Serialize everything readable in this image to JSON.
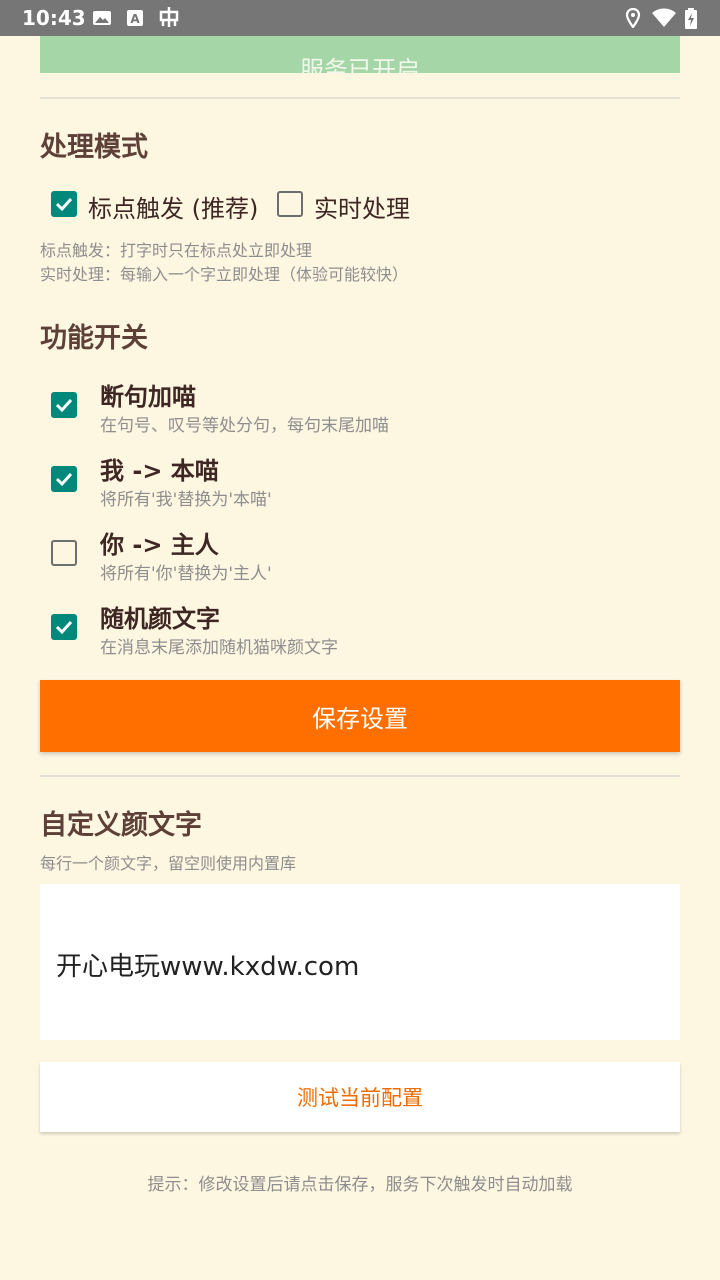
{
  "status_bar": {
    "time": "10:43",
    "left_icons": [
      "image-icon",
      "text-a-icon",
      "bug-icon"
    ],
    "right_icons": [
      "location-icon",
      "wifi-icon",
      "battery-icon"
    ]
  },
  "service_button": {
    "label": "服务已开启",
    "color": "#A5D6A7"
  },
  "mode_section": {
    "title": "处理模式",
    "options": [
      {
        "label": "标点触发 (推荐)",
        "checked": true
      },
      {
        "label": "实时处理",
        "checked": false
      }
    ],
    "desc_line1": "标点触发：打字时只在标点处立即处理",
    "desc_line2": "实时处理：每输入一个字立即处理（体验可能较快）"
  },
  "features_section": {
    "title": "功能开关",
    "items": [
      {
        "title": "断句加喵",
        "subtitle": "在句号、叹号等处分句，每句末尾加喵",
        "checked": true
      },
      {
        "title": "我 -> 本喵",
        "subtitle": "将所有'我'替换为'本喵'",
        "checked": true
      },
      {
        "title": "你 -> 主人",
        "subtitle": "将所有'你'替换为'主人'",
        "checked": false
      },
      {
        "title": "随机颜文字",
        "subtitle": "在消息末尾添加随机猫咪颜文字",
        "checked": true
      }
    ]
  },
  "save_button": {
    "label": "保存设置",
    "color": "#FF6F00"
  },
  "custom_section": {
    "title": "自定义颜文字",
    "desc": "每行一个颜文字，留空则使用内置库",
    "input_value": "开心电玩www.kxdw.com"
  },
  "test_button": {
    "label": "测试当前配置"
  },
  "hint": "提示：修改设置后请点击保存，服务下次触发时自动加载",
  "colors": {
    "background": "#FDF6E1",
    "accent_checkbox": "#00897B",
    "title_brown": "#5D4037"
  }
}
